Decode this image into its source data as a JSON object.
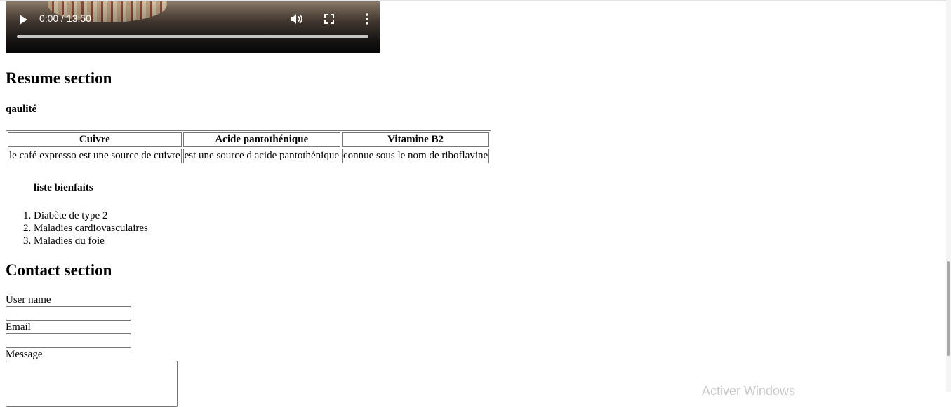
{
  "video": {
    "time": "0:00 / 13:50",
    "progress": 0,
    "icons": [
      "play-icon",
      "volume-icon",
      "fullscreen-icon",
      "more-options-icon"
    ]
  },
  "resume": {
    "heading": "Resume section",
    "quality_label": "qaulité",
    "table": {
      "headers": [
        "Cuivre",
        "Acide pantothénique",
        "Vitamine B2"
      ],
      "rows": [
        [
          "le café expresso est une source de cuivre",
          "est une source d acide pantothénique",
          "connue sous le nom de riboflavine"
        ]
      ]
    },
    "benefits_title": "liste bienfaits",
    "benefits": [
      "Diabète de type 2",
      "Maladies cardiovasculaires",
      "Maladies du foie"
    ]
  },
  "contact": {
    "heading": "Contact section",
    "username_label": "User name",
    "username_value": "",
    "email_label": "Email",
    "email_value": "",
    "message_label": "Message",
    "message_value": ""
  },
  "watermark": "Activer Windows"
}
